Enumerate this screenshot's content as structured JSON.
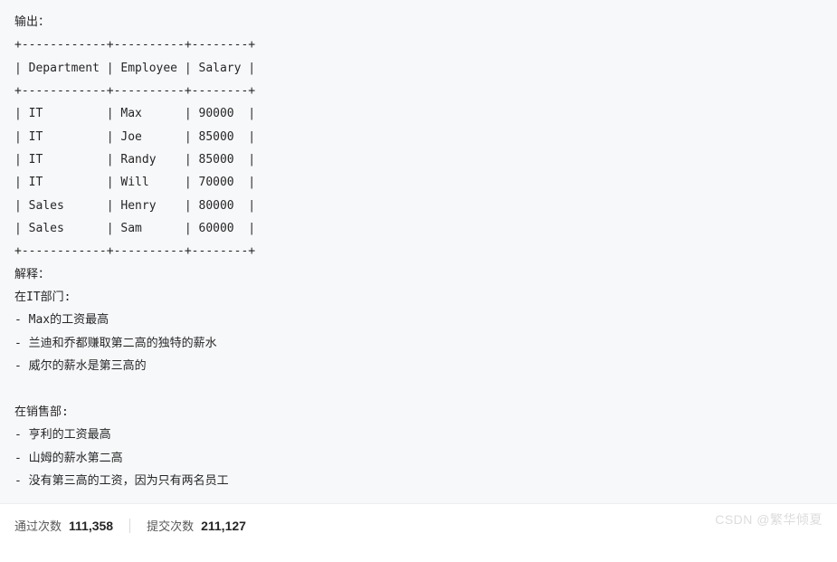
{
  "code": {
    "output_label": "输出：",
    "divider": "+------------+----------+--------+",
    "header": "| Department | Employee | Salary |",
    "rows": [
      "| IT         | Max      | 90000  |",
      "| IT         | Joe      | 85000  |",
      "| IT         | Randy    | 85000  |",
      "| IT         | Will     | 70000  |",
      "| Sales      | Henry    | 80000  |",
      "| Sales      | Sam      | 60000  |"
    ],
    "explain_label": "解释：",
    "it_header": "在IT部门:",
    "it_points": [
      "- Max的工资最高",
      "- 兰迪和乔都赚取第二高的独特的薪水",
      "- 威尔的薪水是第三高的"
    ],
    "sales_header": "在销售部:",
    "sales_points": [
      "- 亨利的工资最高",
      "- 山姆的薪水第二高",
      "- 没有第三高的工资，因为只有两名员工"
    ]
  },
  "stats": {
    "pass_label": "通过次数",
    "pass_value": "111,358",
    "submit_label": "提交次数",
    "submit_value": "211,127"
  },
  "watermark": "CSDN @繁华倾夏"
}
